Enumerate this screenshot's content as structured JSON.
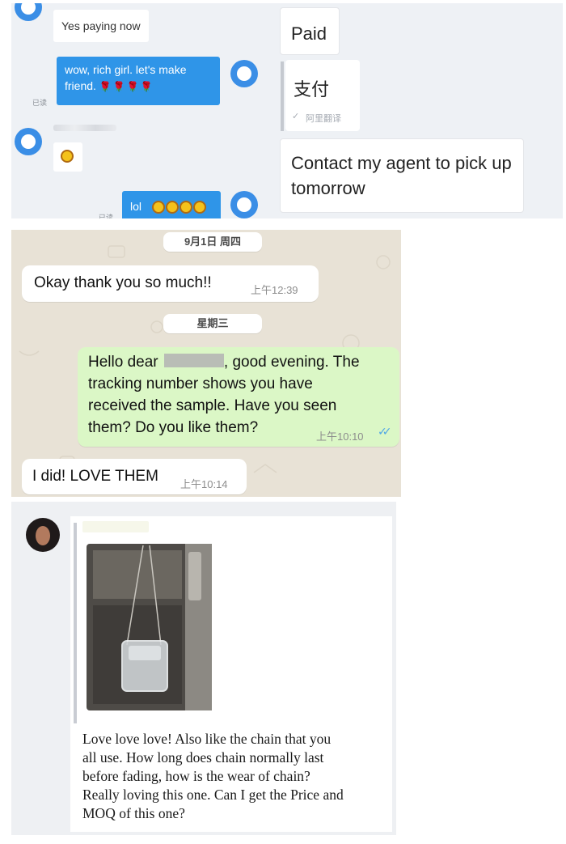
{
  "chat_left": {
    "msg_yes_paying": "Yes paying now",
    "msg_rich_girl": "wow, rich girl.  let's make friend.",
    "read_label_1": "已读",
    "read_label_2": "已读",
    "msg_lol": "lol",
    "accent_color": "#2f95e8"
  },
  "chat_translate": {
    "msg_paid": "Paid",
    "msg_paid_translation": "支付",
    "translator_label": "阿里翻译",
    "msg_agent": "Contact my agent to pick up tomorrow"
  },
  "whatsapp": {
    "date_1": "9月1日 周四",
    "msg_1_text": "Okay thank you so much!!",
    "msg_1_time": "上午12:39",
    "date_2": "星期三",
    "msg_2_text_a": "Hello dear",
    "msg_2_text_b": ", good evening. The",
    "msg_2_line_2": "tracking number shows you have",
    "msg_2_line_3": "received the sample. Have you seen",
    "msg_2_line_4": "them? Do you like them?",
    "msg_2_time": "上午10:10",
    "msg_3_text": "I did! LOVE THEM",
    "msg_3_time": "上午10:14",
    "outgoing_color": "#dbf7c6",
    "tick_color": "#4fa6e6"
  },
  "post": {
    "message_lines": [
      "Love love love! Also like the chain that you",
      "all use. How long does chain normally last",
      "before fading, how is the wear  of chain?",
      "Really loving this one. Can I get the Price and",
      "MOQ of this one?"
    ]
  }
}
